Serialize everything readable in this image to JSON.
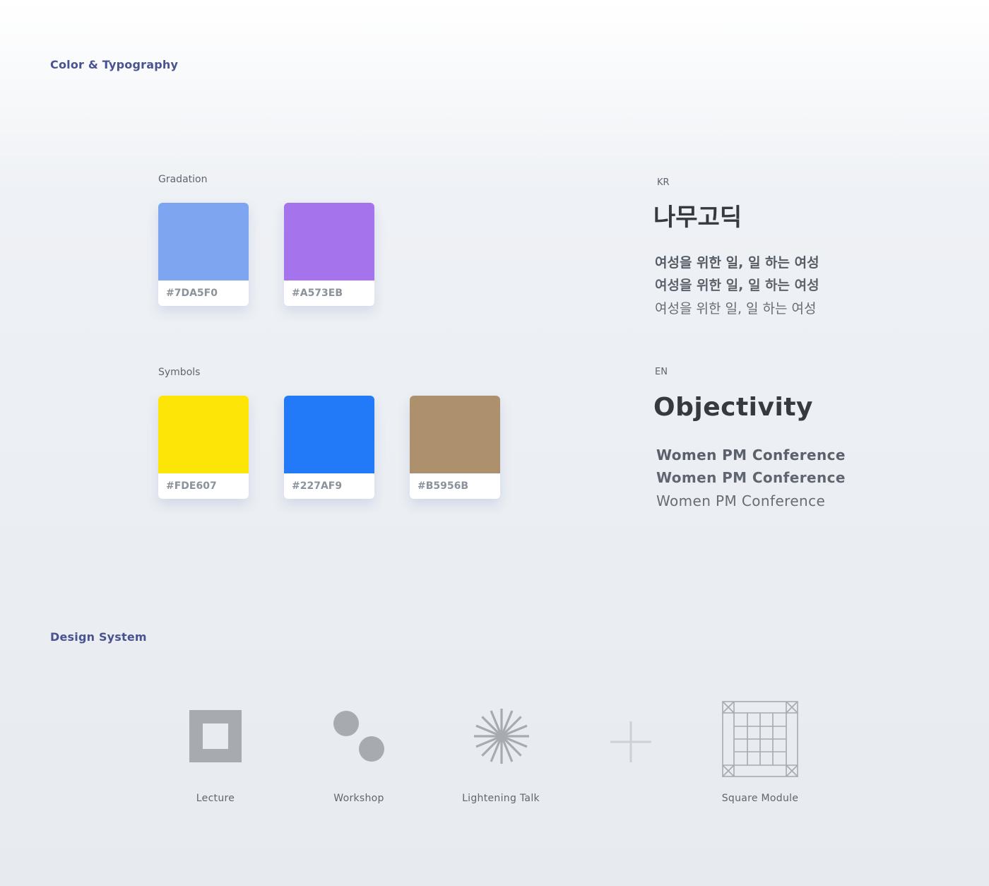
{
  "sections": {
    "color_typography": "Color & Typography",
    "design_system": "Design System"
  },
  "gradation": {
    "label": "Gradation",
    "swatches": [
      {
        "hex": "#7DA5F0",
        "color": "#7DA5F0"
      },
      {
        "hex": "#A573EB",
        "color": "#A573EB"
      }
    ]
  },
  "symbols": {
    "label": "Symbols",
    "swatches": [
      {
        "hex": "#FDE607",
        "color": "#FDE607"
      },
      {
        "hex": "#227AF9",
        "color": "#227AF9"
      },
      {
        "hex": "#B5956B",
        "color": "#AD916D"
      }
    ]
  },
  "typography": {
    "kr": {
      "label": "KR",
      "font_name": "나무고딕",
      "samples": [
        "여성을 위한 일, 일 하는 여성",
        "여성을 위한 일, 일 하는 여성",
        "여성을 위한 일, 일 하는 여성"
      ]
    },
    "en": {
      "label": "EN",
      "font_name": "Objectivity",
      "samples": [
        "Women PM Conference",
        "Women PM Conference",
        "Women PM Conference"
      ]
    }
  },
  "design_system": {
    "icon_color": "#A7AAAF",
    "plus_color": "#CDD1D6",
    "items": [
      {
        "label": "Lecture",
        "icon": "square-frame-icon"
      },
      {
        "label": "Workshop",
        "icon": "two-circles-icon"
      },
      {
        "label": "Lightening Talk",
        "icon": "starburst-icon"
      },
      {
        "label": "",
        "icon": "plus-icon"
      },
      {
        "label": "Square Module",
        "icon": "grid-module-icon"
      }
    ]
  }
}
